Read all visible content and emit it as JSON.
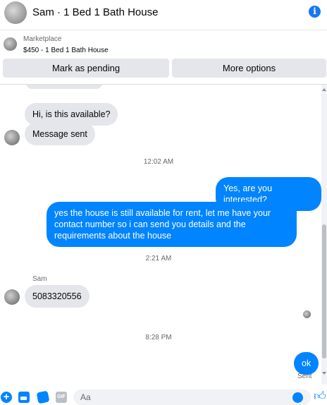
{
  "header": {
    "title": "Sam · 1 Bed 1 Bath House",
    "info_glyph": "i"
  },
  "listing": {
    "source": "Marketplace",
    "price_title": "$450 - 1 Bed 1 Bath House",
    "mark_pending_label": "Mark as pending",
    "more_options_label": "More options"
  },
  "messages": {
    "m1": "Hi, is this available?",
    "m2": "Message sent",
    "t1": "12:02 AM",
    "m3": "Yes, are you interested?",
    "m4": "yes the house is still available for rent, let me have your contact number so i can send you details and the requirements about the house",
    "t2": "2:21 AM",
    "sender": "Sam",
    "m5": "5083320556",
    "t3": "8:28 PM",
    "m6": "ok",
    "status": "Sent"
  },
  "composer": {
    "placeholder": "Aa",
    "plus_glyph": "+",
    "gif_glyph": "GIF"
  },
  "colors": {
    "accent": "#0084ff",
    "incoming": "#e4e6eb",
    "info": "#1877f2"
  },
  "icons": [
    "info-icon",
    "plus-icon",
    "image-icon",
    "sticker-icon",
    "gif-icon",
    "emoji-icon",
    "like-icon"
  ]
}
